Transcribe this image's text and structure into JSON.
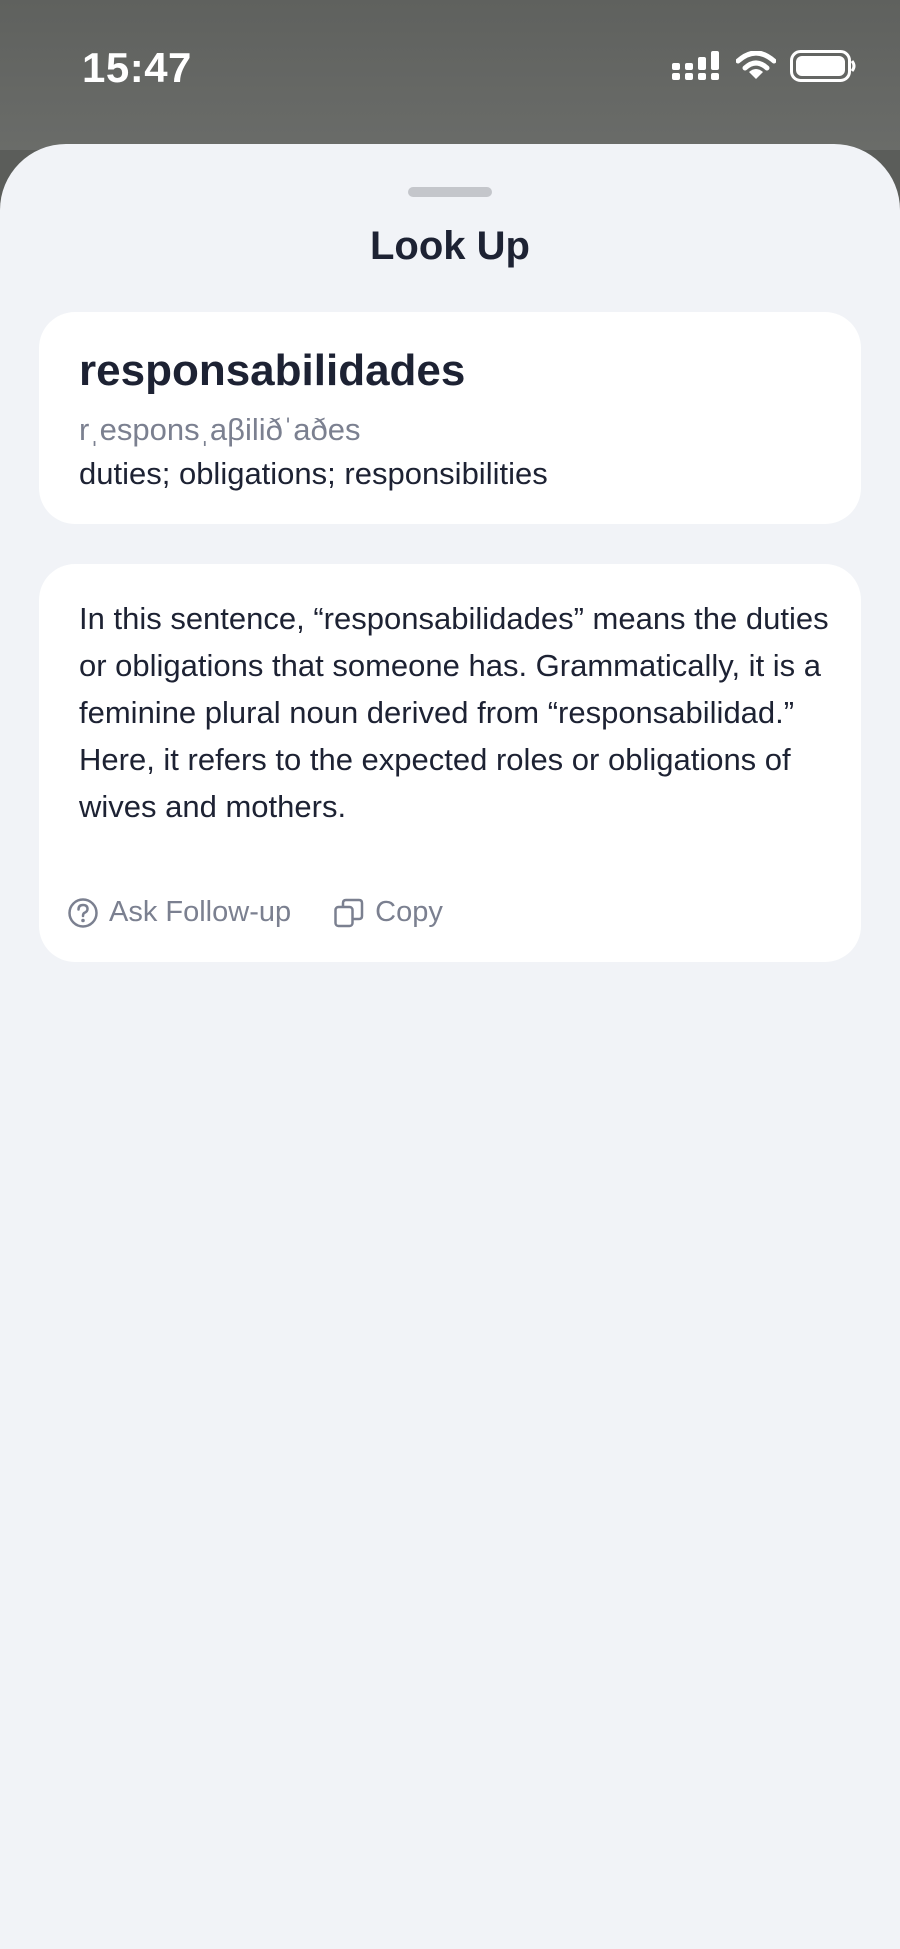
{
  "status_bar": {
    "time": "15:47",
    "icons": [
      "signal-icon",
      "wifi-icon",
      "battery-icon"
    ]
  },
  "sheet": {
    "title": "Look Up"
  },
  "entry": {
    "word": "responsabilidades",
    "phonetic": "rˌesponsˌaβiliðˈaðes",
    "definition": "duties; obligations; responsibilities"
  },
  "explanation": {
    "text": "In this sentence, “responsabilidades” means the duties or obligations that someone has. Grammatically, it is a feminine plural noun derived from “responsabilidad.” Here, it refers to the expected roles or obligations of wives and mothers.",
    "ask_label": "Ask Follow-up",
    "copy_label": "Copy"
  },
  "colors": {
    "sheet_background": "#f1f3f7",
    "card_background": "#ffffff",
    "primary_text": "#1d2233",
    "secondary_text": "#7b8090"
  }
}
